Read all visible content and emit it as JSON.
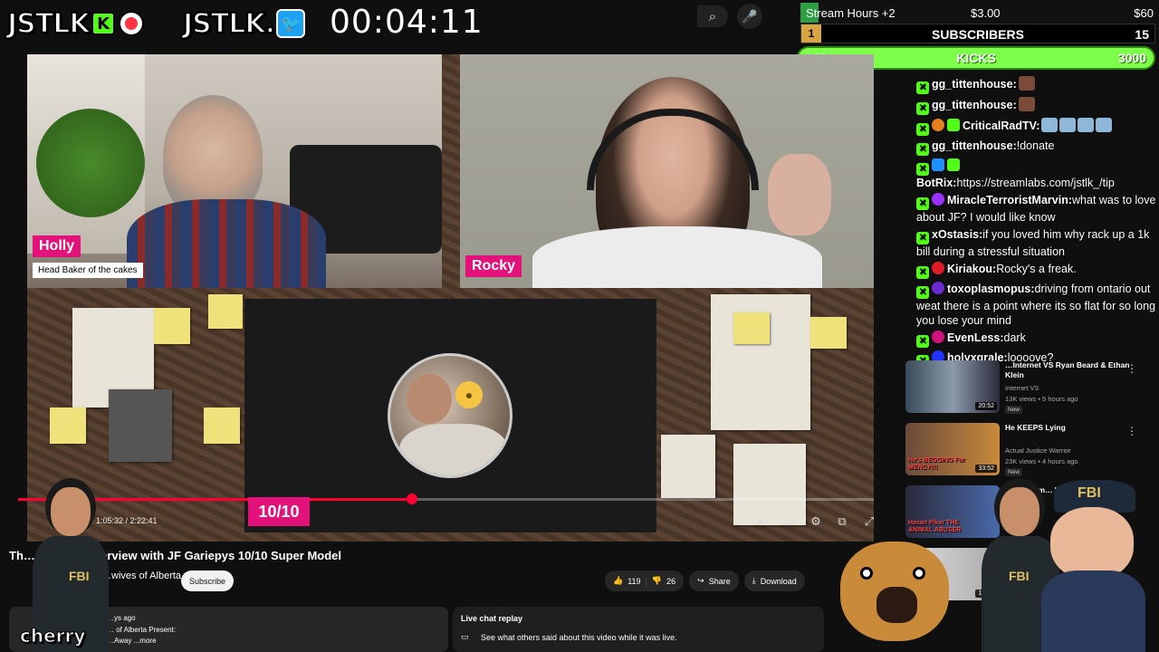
{
  "overlay": {
    "logo_text": "JSTLK",
    "logo_kick_letter": "K",
    "logo2_text": "JSTLK.",
    "timer": "00:04:11",
    "search_icon": "search-icon",
    "mic_icon": "mic-icon"
  },
  "goals": {
    "stream_hours": {
      "label": "Stream Hours +2",
      "current": "$3.00",
      "target": "$60",
      "progress": 0.05
    },
    "subscribers": {
      "rank": "1",
      "title": "SUBSCRIBERS",
      "target": "15"
    },
    "kicks": {
      "current": "3154",
      "title": "KICKS",
      "target": "3000",
      "progress": 1.0
    }
  },
  "video": {
    "cam1_name": "Holly",
    "cam1_subtitle": "Head Baker of the cakes",
    "cam2_name": "Rocky",
    "rating": "10/10",
    "time": "1:05:32 / 2:22:41",
    "progress": 0.46,
    "title": "Th… …away! Interview with JF Gariepys 10/10 Super Model",
    "channel": "…wives of Alberta",
    "subscribe_label": "Subscribe",
    "likes": "119",
    "dislikes": "26",
    "share_label": "Share",
    "download_label": "Download",
    "description_line1": "…ys ago",
    "description_line2": "… of Alberta Present:",
    "description_line3": "…Away ...more",
    "live_chat_title": "Live chat replay",
    "live_chat_text": "See what others said about this video while it was live.",
    "overlay_name": "cherry"
  },
  "chat": [
    {
      "user": "gg_tittenhouse:",
      "text": "",
      "badges": [
        "check"
      ],
      "emotes": 1
    },
    {
      "user": "gg_tittenhouse:",
      "text": "",
      "badges": [
        "check"
      ],
      "emotes": 1
    },
    {
      "user": "CriticalRadTV:",
      "text": "",
      "badges": [
        "check",
        "orange",
        "gift"
      ],
      "emotes": 4
    },
    {
      "user": "gg_tittenhouse:",
      "text": "!donate",
      "badges": [
        "check"
      ],
      "emotes": 0
    },
    {
      "user": "BotRix:",
      "text": "https://streamlabs.com/jstlk_/tip",
      "badges": [
        "check",
        "blue",
        "gear"
      ],
      "emotes": 0
    },
    {
      "user": "MiracleTerroristMarvin:",
      "text": "what was to love about JF? I would like know",
      "badges": [
        "check",
        "purple"
      ],
      "emotes": 0
    },
    {
      "user": "xOstasis:",
      "text": "if you loved him why rack up a 1k bill during a stressful situation",
      "badges": [
        "check"
      ],
      "emotes": 0
    },
    {
      "user": "Kiriakou:",
      "text": "Rocky's a freak.",
      "badges": [
        "check",
        "red"
      ],
      "emotes": 0
    },
    {
      "user": "toxoplasmopus:",
      "text": "driving from ontario out weat there is a point where its so flat for so long you lose your mind",
      "badges": [
        "check",
        "violet"
      ],
      "emotes": 0
    },
    {
      "user": "EvenLess:",
      "text": "dark",
      "badges": [
        "check",
        "magenta"
      ],
      "emotes": 0
    },
    {
      "user": "holyxgrale:",
      "text": "loooove?",
      "badges": [
        "check",
        "navy"
      ],
      "emotes": 0
    }
  ],
  "recommendations": [
    {
      "title": "…Internet VS Ryan Beard & Ethan Klein",
      "channel": "Internet VS",
      "views": "13K views • 5 hours ago",
      "badge": "New",
      "duration": "20:52"
    },
    {
      "title": "He KEEPS Lying",
      "channel": "Actual Justice Warrior",
      "views": "23K views • 4 hours ago",
      "badge": "New",
      "duration": "33:52",
      "thumb_text": "He's BEGGING For MERCY!!!"
    },
    {
      "title": "Piker Anim… Wom…",
      "channel": "",
      "views": "3 day…",
      "badge": "",
      "duration": "",
      "thumb_text": "Hasan Piker THE ANIMAL ABUSER"
    },
    {
      "title": "",
      "channel": "",
      "views": "",
      "badge": "",
      "duration": "16:07"
    }
  ],
  "colors": {
    "kick_green": "#53fc18",
    "name_tag_pink": "#e3127b",
    "progress_red": "#ff0033",
    "background": "#0f0f0f"
  }
}
